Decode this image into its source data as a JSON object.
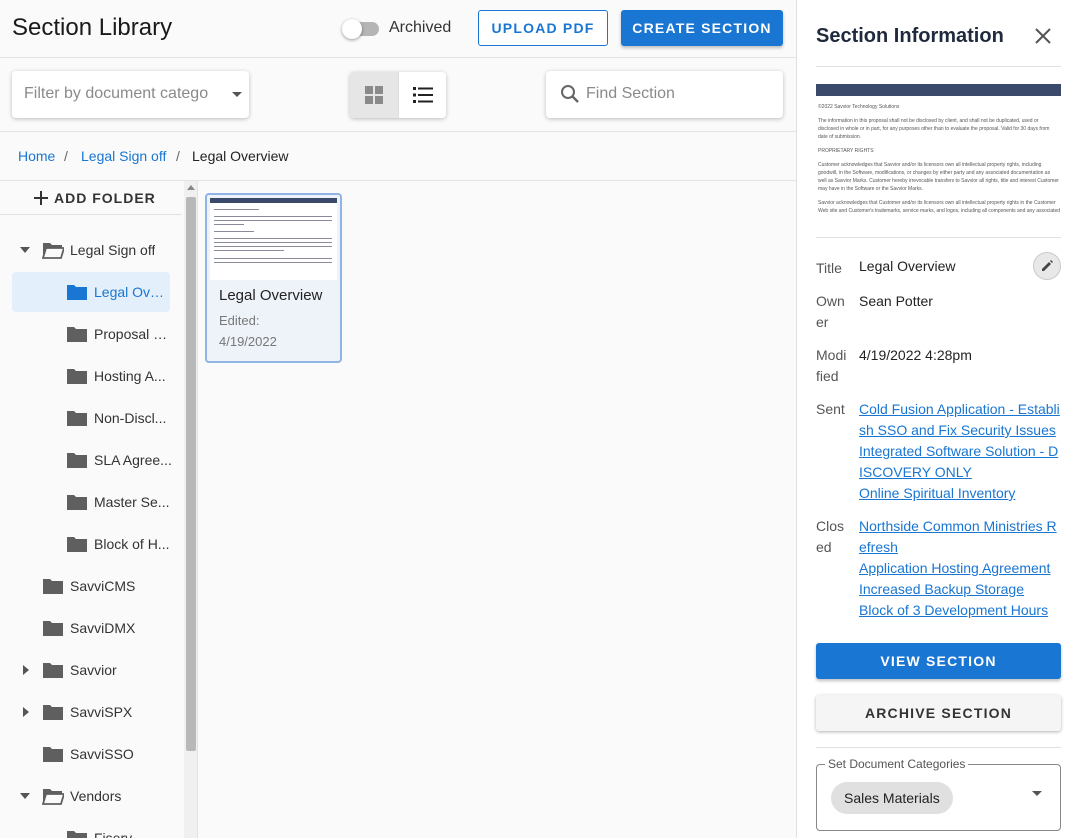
{
  "header": {
    "title": "Section Library",
    "archived_label": "Archived",
    "upload_label": "UPLOAD PDF",
    "create_label": "CREATE SECTION"
  },
  "toolbar": {
    "filter_placeholder": "Filter by document category",
    "search_placeholder": "Find Section"
  },
  "breadcrumb": {
    "items": [
      "Home",
      "Legal Sign off",
      "Legal Overview"
    ],
    "separator": "/"
  },
  "sidebar": {
    "add_folder_label": "ADD FOLDER",
    "tree": [
      {
        "label": "Legal Sign off",
        "expanded": true,
        "level": 0
      },
      {
        "label": "Legal Overview",
        "selected": true,
        "level": 1
      },
      {
        "label": "Proposal S...",
        "level": 1
      },
      {
        "label": "Hosting A...",
        "level": 1
      },
      {
        "label": "Non-Discl...",
        "level": 1
      },
      {
        "label": "SLA Agree...",
        "level": 1
      },
      {
        "label": "Master Se...",
        "level": 1
      },
      {
        "label": "Block of H...",
        "level": 1
      },
      {
        "label": "SavviCMS",
        "level": 0
      },
      {
        "label": "SavviDMX",
        "level": 0
      },
      {
        "label": "Savvior",
        "collapsed": true,
        "level": 0
      },
      {
        "label": "SavviSPX",
        "collapsed": true,
        "level": 0
      },
      {
        "label": "SavviSSO",
        "level": 0
      },
      {
        "label": "Vendors",
        "expanded": true,
        "level": 0
      },
      {
        "label": "Fiserv",
        "level": 1
      }
    ]
  },
  "main": {
    "card": {
      "title": "Legal Overview",
      "edited_label": "Edited:",
      "edited_date": "4/19/2022"
    }
  },
  "panel": {
    "title": "Section Information",
    "preview_lines": [
      "©2022 Savvior Technology Solutions",
      "The information in this proposal shall not be disclosed by client, and shall not be duplicated, used or",
      "disclosed in whole or in part, for any purposes other than to evaluate the proposal.  Valid for 30 days from",
      "date of submission.",
      "PROPRIETARY RIGHTS",
      "Customer acknowledges that Savvior and/or its licensors own all intellectual property rights, including",
      "goodwill, in the Software, modifications, or changes by either party and any associated documentation as",
      "well as Savvior Marks.  Customer hereby irrevocable transfers to Savvior all rights, title and interest Customer",
      "may have in the Software or the Savvior Marks.",
      "Savvior acknowledges that Customer and/or its licensors own all intellectual property rights in the Customer",
      "Web site and Customer's trademarks, service marks, and logos, including all components and any associated"
    ],
    "title_label": "Title",
    "title_value": "Legal Overview",
    "owner_label": "Owner",
    "owner_value": "Sean Potter",
    "modified_label": "Modified",
    "modified_value": "4/19/2022 4:28pm",
    "sent_label": "Sent",
    "sent_links": [
      "Cold Fusion Application - Establish SSO and Fix Security Issues",
      "Integrated Software Solution - DISCOVERY ONLY",
      "Online Spiritual Inventory"
    ],
    "closed_label": "Closed",
    "closed_links": [
      "Northside Common Ministries Refresh",
      "Application Hosting Agreement",
      "Increased Backup Storage",
      "Block of 3 Development Hours"
    ],
    "view_label": "VIEW SECTION",
    "archive_label": "ARCHIVE SECTION",
    "categories_label": "Set Document Categories",
    "category_chip": "Sales Materials"
  },
  "colors": {
    "primary": "#1976d2",
    "selected_bg": "#e3effb",
    "folder": "#5f5f5f"
  }
}
